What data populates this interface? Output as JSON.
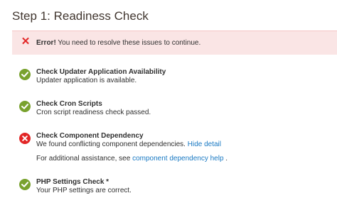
{
  "page": {
    "title": "Step 1: Readiness Check"
  },
  "error": {
    "strong": "Error!",
    "message": " You need to resolve these issues to continue."
  },
  "checks": [
    {
      "title": "Check Updater Application Availability",
      "description": "Updater application is available.",
      "status": "passed"
    },
    {
      "title": "Check Cron Scripts",
      "description": "Cron script readiness check passed.",
      "status": "passed"
    },
    {
      "title": "Check Component Dependency",
      "description": "We found conflicting component dependencies.",
      "link": "Hide detail",
      "assistance_prefix": "For additional assistance, see ",
      "assistance_link": "component dependency help",
      "assistance_suffix": " .",
      "status": "failed"
    },
    {
      "title": "PHP Settings Check *",
      "description": "Your PHP settings are correct.",
      "status": "passed"
    }
  ],
  "colors": {
    "success": "#79a22e",
    "error": "#e22626",
    "link": "#1979c3",
    "error_bg": "#fae5e5"
  },
  "icons": {
    "success": "check-icon",
    "failure": "x-icon"
  }
}
